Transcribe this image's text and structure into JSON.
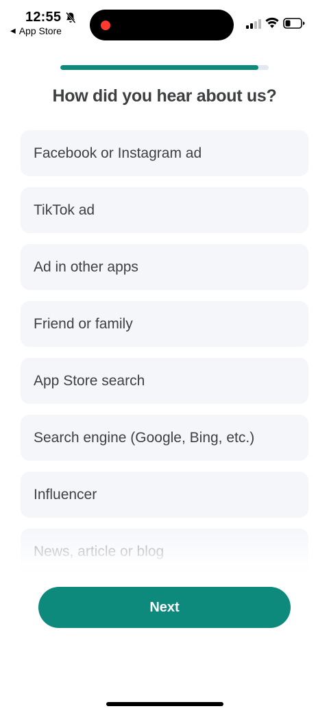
{
  "status_bar": {
    "time": "12:55",
    "back_label": "App Store",
    "back_arrow": "◀",
    "icons": [
      "bell-off-icon",
      "signal-icon",
      "wifi-icon",
      "battery-icon"
    ],
    "recording_color": "#ff3b30"
  },
  "progress": {
    "fraction": 0.95,
    "color": "#0e8a7c",
    "track_color": "#e3e7ef"
  },
  "title": "How did you hear about us?",
  "options": [
    "Facebook or Instagram ad",
    "TikTok ad",
    "Ad in other apps",
    "Friend or family",
    "App Store search",
    "Search engine (Google, Bing, etc.)",
    "Influencer",
    "News, article or blog"
  ],
  "next_button": {
    "label": "Next",
    "color": "#0e8a7c"
  },
  "colors": {
    "option_background": "#f4f6fa",
    "text": "#3d3f41"
  }
}
